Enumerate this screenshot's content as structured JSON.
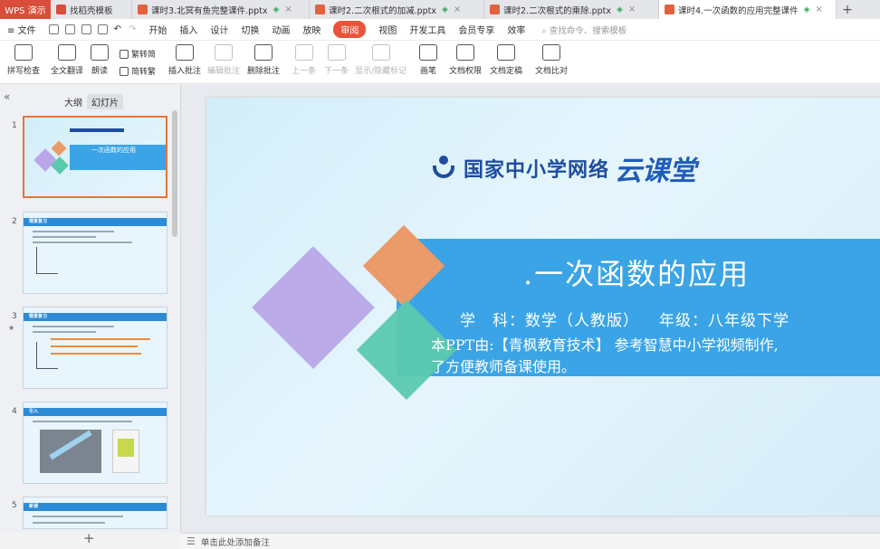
{
  "app": {
    "name": "WPS 演示"
  },
  "tabs": [
    {
      "label": "找稻壳模板",
      "icon": "wps-template-icon",
      "color": "#d94e3a"
    },
    {
      "label": "课时3.北冥有鱼完整课件.pptx",
      "icon": "pptx-file-icon",
      "color": "#e2623b"
    },
    {
      "label": "课时2.二次根式的加减.pptx",
      "icon": "pptx-file-icon",
      "color": "#e2623b"
    },
    {
      "label": "课时2.二次根式的乘除.pptx",
      "icon": "pptx-file-icon",
      "color": "#e2623b"
    },
    {
      "label": "课时4.一次函数的应用完整课件",
      "icon": "pptx-file-icon",
      "color": "#e2623b",
      "active": true
    }
  ],
  "menu": {
    "file": "文件",
    "items": [
      "开始",
      "插入",
      "设计",
      "切换",
      "动画",
      "放映",
      "审阅",
      "视图",
      "开发工具",
      "会员专享",
      "效率"
    ],
    "active": "审阅",
    "search_placeholder": "查找命令、搜索模板"
  },
  "ribbon": {
    "spell_check": "拼写检查",
    "full_translate": "全文翻译",
    "read_aloud": "朗读",
    "to_simplified": "繁转简",
    "simplified_traditional": "简转繁",
    "insert_comment": "插入批注",
    "edit_comment": "编辑批注",
    "delete_comment": "删除批注",
    "previous": "上一条",
    "next": "下一条",
    "show_hide_markup": "显示/隐藏标记",
    "ink": "画笔",
    "doc_permission": "文档权限",
    "doc_finalize": "文档定稿",
    "doc_compare": "文档比对"
  },
  "leftpane": {
    "tab_outline": "大纲",
    "tab_slides": "幻灯片",
    "slides": [
      {
        "num": "1",
        "header": "",
        "title": "一次函数的应用"
      },
      {
        "num": "2",
        "header": "情景复习"
      },
      {
        "num": "3",
        "header": "情景复习"
      },
      {
        "num": "4",
        "header": "引入"
      },
      {
        "num": "5",
        "header": "新课"
      }
    ],
    "add_slide": "+"
  },
  "slide": {
    "logo_text": "国家中小学网络",
    "logo_brand": "云课堂",
    "title": ".一次函数的应用",
    "subject": "学　科：数学（人教版）",
    "grade": "年级：八年级下学",
    "note_line1": "本PPT由:【青枫教育技术】 参考智慧中小学视频制作,",
    "note_line2": "了方便教师备课使用。"
  },
  "notes": {
    "placeholder": "单击此处添加备注"
  }
}
